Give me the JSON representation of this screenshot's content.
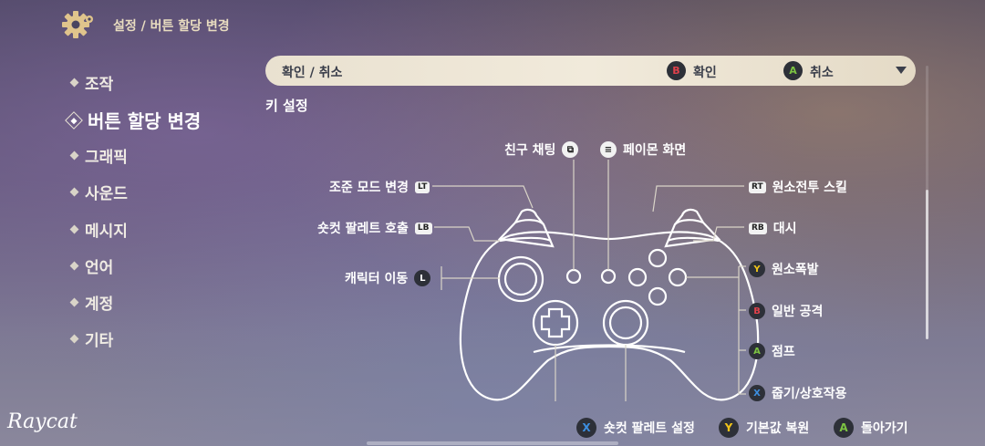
{
  "topbar": {
    "title": "설정 / 버튼 할당 변경",
    "icon": "gear-icon"
  },
  "sidebar": {
    "items": [
      {
        "label": "조작",
        "active": false
      },
      {
        "label": "버튼 할당 변경",
        "active": true
      },
      {
        "label": "그래픽",
        "active": false
      },
      {
        "label": "사운드",
        "active": false
      },
      {
        "label": "메시지",
        "active": false
      },
      {
        "label": "언어",
        "active": false
      },
      {
        "label": "계정",
        "active": false
      },
      {
        "label": "기타",
        "active": false
      }
    ]
  },
  "preset": {
    "label": "확인 / 취소",
    "confirm": {
      "glyph": "B",
      "label": "확인",
      "color": "#e0414b"
    },
    "cancel": {
      "glyph": "A",
      "label": "취소",
      "color": "#7cc442"
    }
  },
  "section_title": "키 설정",
  "controls": {
    "friend_chat": {
      "label": "친구 채팅",
      "icon": "view-button-icon"
    },
    "paimon_menu": {
      "label": "페이몬 화면",
      "icon": "menu-button-icon"
    },
    "aim_toggle": {
      "label": "조준 모드 변경",
      "glyph": "LT"
    },
    "shortcut_wheel": {
      "label": "숏컷 팔레트 호출",
      "glyph": "LB"
    },
    "move": {
      "label": "캐릭터 이동",
      "glyph": "L"
    },
    "elemental_skill": {
      "label": "원소전투 스킬",
      "glyph": "RT"
    },
    "dash": {
      "label": "대시",
      "glyph": "RB"
    },
    "elemental_burst": {
      "label": "원소폭발",
      "glyph": "Y",
      "color": "#f0c419"
    },
    "normal_attack": {
      "label": "일반 공격",
      "glyph": "B",
      "color": "#e0414b"
    },
    "jump": {
      "label": "점프",
      "glyph": "A",
      "color": "#7cc442"
    },
    "interact": {
      "label": "줍기/상호작용",
      "glyph": "X",
      "color": "#3d8fe0"
    }
  },
  "footer": {
    "hints": [
      {
        "glyph": "X",
        "label": "숏컷 팔레트 설정",
        "color": "#3d8fe0"
      },
      {
        "glyph": "Y",
        "label": "기본값 복원",
        "color": "#f0c419"
      },
      {
        "glyph": "A",
        "label": "돌아가기",
        "color": "#7cc442"
      }
    ]
  },
  "watermark": "Raycat"
}
